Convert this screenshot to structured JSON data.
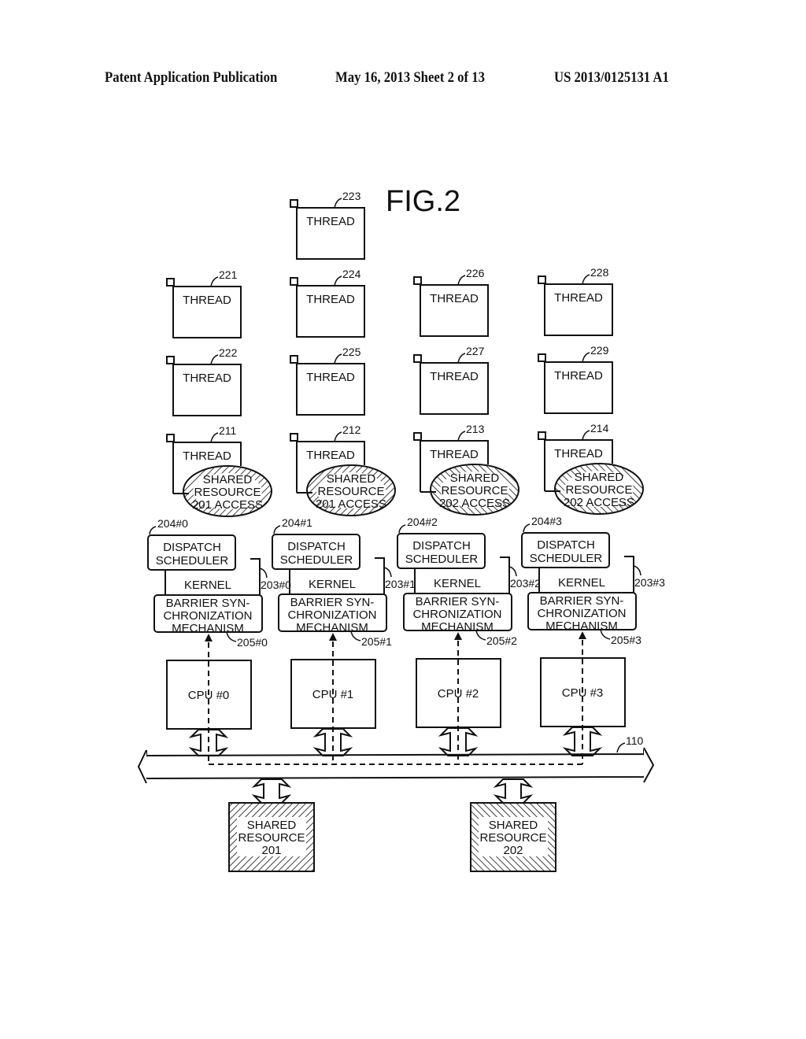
{
  "header": {
    "publication": "Patent Application Publication",
    "date_sheet": "May 16, 2013  Sheet 2 of 13",
    "number": "US 2013/0125131 A1"
  },
  "figure": {
    "title": "FIG.2",
    "thread_label": "THREAD",
    "threads": [
      {
        "ref": "223",
        "col": 1,
        "row": 0
      },
      {
        "ref": "221",
        "col": 0,
        "row": 1
      },
      {
        "ref": "224",
        "col": 1,
        "row": 1
      },
      {
        "ref": "226",
        "col": 2,
        "row": 1
      },
      {
        "ref": "228",
        "col": 3,
        "row": 1
      },
      {
        "ref": "222",
        "col": 0,
        "row": 2
      },
      {
        "ref": "225",
        "col": 1,
        "row": 2
      },
      {
        "ref": "227",
        "col": 2,
        "row": 2
      },
      {
        "ref": "229",
        "col": 3,
        "row": 2
      }
    ],
    "access_threads": [
      {
        "ref": "211",
        "access_lines": [
          "SHARED",
          "RESOURCE",
          "201 ACCESS"
        ],
        "hatch": "back"
      },
      {
        "ref": "212",
        "access_lines": [
          "SHARED",
          "RESOURCE",
          "201 ACCESS"
        ],
        "hatch": "back"
      },
      {
        "ref": "213",
        "access_lines": [
          "SHARED",
          "RESOURCE",
          "202 ACCESS"
        ],
        "hatch": "fwd"
      },
      {
        "ref": "214",
        "access_lines": [
          "SHARED",
          "RESOURCE",
          "202 ACCESS"
        ],
        "hatch": "fwd"
      }
    ],
    "stacks": [
      {
        "scheduler_ref": "204#0",
        "kernel_ref": "203#0",
        "barrier_ref": "205#0",
        "cpu": "CPU #0"
      },
      {
        "scheduler_ref": "204#1",
        "kernel_ref": "203#1",
        "barrier_ref": "205#1",
        "cpu": "CPU #1"
      },
      {
        "scheduler_ref": "204#2",
        "kernel_ref": "203#2",
        "barrier_ref": "205#2",
        "cpu": "CPU #2"
      },
      {
        "scheduler_ref": "204#3",
        "kernel_ref": "203#3",
        "barrier_ref": "205#3",
        "cpu": "CPU #3"
      }
    ],
    "scheduler_lines": [
      "DISPATCH",
      "SCHEDULER"
    ],
    "kernel_label": "KERNEL",
    "barrier_lines": [
      "BARRIER SYN-",
      "CHRONIZATION",
      "MECHANISM"
    ],
    "bus_ref": "110",
    "shared_resources": [
      {
        "lines": [
          "SHARED",
          "RESOURCE",
          "201"
        ],
        "hatch": "back"
      },
      {
        "lines": [
          "SHARED",
          "RESOURCE",
          "202"
        ],
        "hatch": "fwd"
      }
    ]
  }
}
